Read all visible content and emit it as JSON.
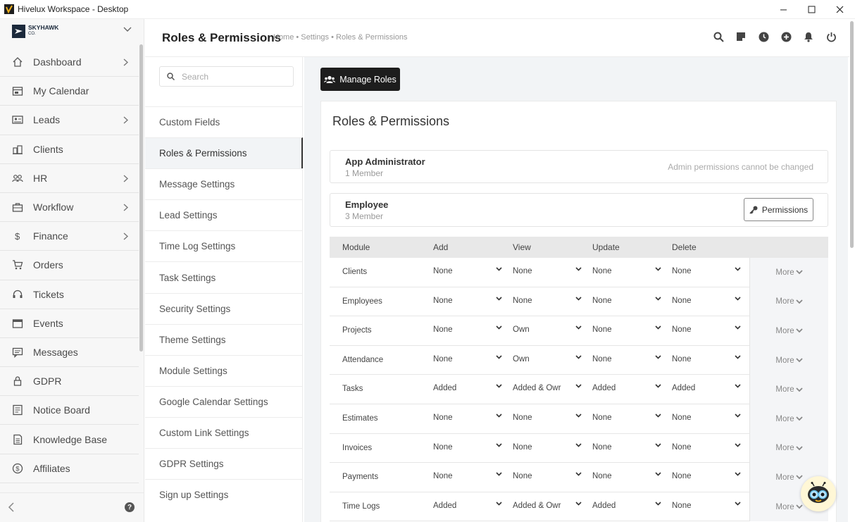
{
  "window": {
    "title": "Hivelux Workspace - Desktop"
  },
  "brand": {
    "name": "SKYHAWK",
    "sub": "CO."
  },
  "sidebar": {
    "items": [
      {
        "label": "Dashboard",
        "icon": "home-icon",
        "has_arrow": true
      },
      {
        "label": "My Calendar",
        "icon": "calendar-icon",
        "has_arrow": false
      },
      {
        "label": "Leads",
        "icon": "leads-card-icon",
        "has_arrow": true
      },
      {
        "label": "Clients",
        "icon": "building-icon",
        "has_arrow": false
      },
      {
        "label": "HR",
        "icon": "people-icon",
        "has_arrow": true
      },
      {
        "label": "Workflow",
        "icon": "briefcase-icon",
        "has_arrow": true
      },
      {
        "label": "Finance",
        "icon": "dollar-icon",
        "has_arrow": true
      },
      {
        "label": "Orders",
        "icon": "cart-icon",
        "has_arrow": false
      },
      {
        "label": "Tickets",
        "icon": "headset-icon",
        "has_arrow": false
      },
      {
        "label": "Events",
        "icon": "event-calendar-icon",
        "has_arrow": false
      },
      {
        "label": "Messages",
        "icon": "message-icon",
        "has_arrow": false
      },
      {
        "label": "GDPR",
        "icon": "lock-icon",
        "has_arrow": false
      },
      {
        "label": "Notice Board",
        "icon": "notice-icon",
        "has_arrow": false
      },
      {
        "label": "Knowledge Base",
        "icon": "book-icon",
        "has_arrow": false
      },
      {
        "label": "Affiliates",
        "icon": "dollar-circle-icon",
        "has_arrow": false
      }
    ]
  },
  "header": {
    "title": "Roles & Permissions",
    "breadcrumb": "Home • Settings • Roles & Permissions"
  },
  "settings_menu": {
    "search_placeholder": "Search",
    "items": [
      {
        "label": "Custom Fields",
        "active": false
      },
      {
        "label": "Roles & Permissions",
        "active": true
      },
      {
        "label": "Message Settings",
        "active": false
      },
      {
        "label": "Lead Settings",
        "active": false
      },
      {
        "label": "Time Log Settings",
        "active": false
      },
      {
        "label": "Task Settings",
        "active": false
      },
      {
        "label": "Security Settings",
        "active": false
      },
      {
        "label": "Theme Settings",
        "active": false
      },
      {
        "label": "Module Settings",
        "active": false
      },
      {
        "label": "Google Calendar Settings",
        "active": false
      },
      {
        "label": "Custom Link Settings",
        "active": false
      },
      {
        "label": "GDPR Settings",
        "active": false
      },
      {
        "label": "Sign up Settings",
        "active": false
      }
    ]
  },
  "main": {
    "manage_roles_label": "Manage Roles",
    "card_title": "Roles & Permissions",
    "roles": [
      {
        "name": "App Administrator",
        "members": "1 Member",
        "note": "Admin permissions cannot be changed"
      },
      {
        "name": "Employee",
        "members": "3 Member",
        "button": "Permissions"
      }
    ],
    "table": {
      "headers": [
        "Module",
        "Add",
        "View",
        "Update",
        "Delete"
      ],
      "more_label": "More",
      "rows": [
        {
          "module": "Clients",
          "add": "None",
          "view": "None",
          "update": "None",
          "delete": "None"
        },
        {
          "module": "Employees",
          "add": "None",
          "view": "None",
          "update": "None",
          "delete": "None"
        },
        {
          "module": "Projects",
          "add": "None",
          "view": "Own",
          "update": "None",
          "delete": "None"
        },
        {
          "module": "Attendance",
          "add": "None",
          "view": "Own",
          "update": "None",
          "delete": "None"
        },
        {
          "module": "Tasks",
          "add": "Added",
          "view": "Added & Owr",
          "update": "Added",
          "delete": "Added"
        },
        {
          "module": "Estimates",
          "add": "None",
          "view": "None",
          "update": "None",
          "delete": "None"
        },
        {
          "module": "Invoices",
          "add": "None",
          "view": "None",
          "update": "None",
          "delete": "None"
        },
        {
          "module": "Payments",
          "add": "None",
          "view": "None",
          "update": "None",
          "delete": "None"
        },
        {
          "module": "Time Logs",
          "add": "Added",
          "view": "Added & Owr",
          "update": "Added",
          "delete": "None"
        }
      ]
    }
  },
  "colors": {
    "accent_dark": "#1d1d1d",
    "sidebar_bg": "#f7f7f7",
    "content_bg": "#f2f4f6"
  }
}
